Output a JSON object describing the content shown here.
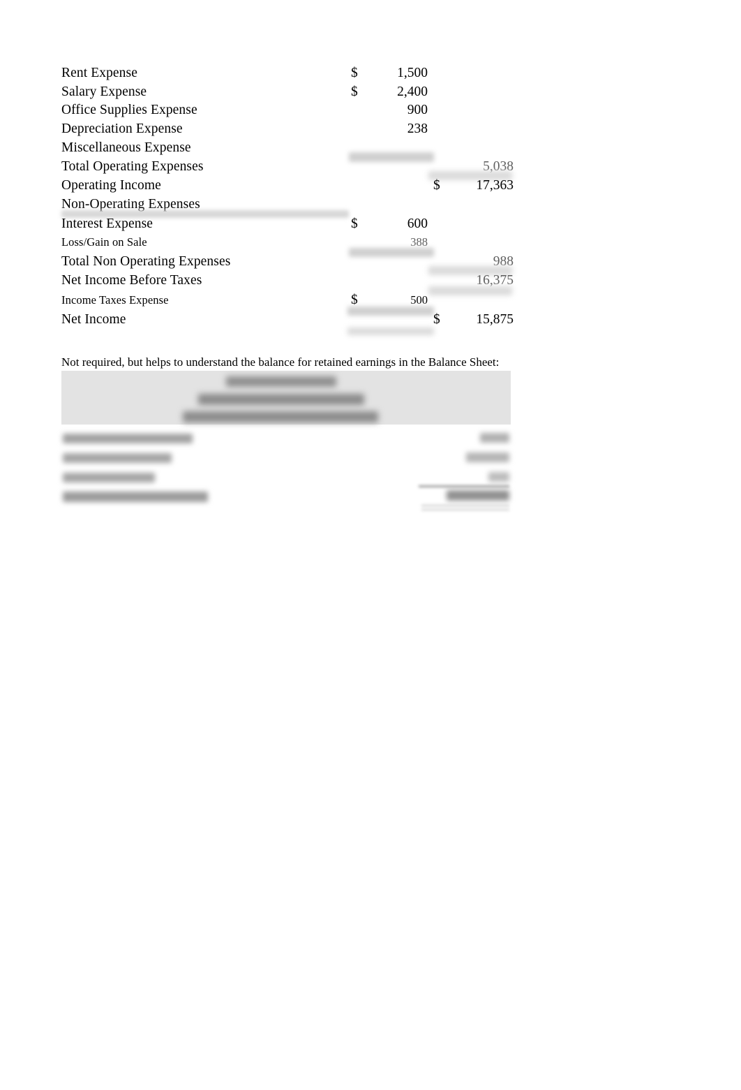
{
  "document": {
    "type": "income-statement-excerpt",
    "currency_symbol": "$"
  },
  "income_statement": {
    "rows": [
      {
        "label": "Rent Expense",
        "currency_a": "$",
        "value_a": "1,500",
        "currency_b": "",
        "value_b": ""
      },
      {
        "label": "Salary Expense",
        "currency_a": "$",
        "value_a": "2,400",
        "currency_b": "",
        "value_b": ""
      },
      {
        "label": "Office Supplies Expense",
        "currency_a": "",
        "value_a": "900",
        "currency_b": "",
        "value_b": ""
      },
      {
        "label": "Depreciation Expense",
        "currency_a": "",
        "value_a": "238",
        "currency_b": "",
        "value_b": ""
      },
      {
        "label": "Miscellaneous Expense",
        "currency_a": "",
        "value_a": "",
        "currency_b": "",
        "value_b": ""
      },
      {
        "label": "Total Operating Expenses",
        "currency_a": "",
        "value_a": "",
        "currency_b": "",
        "value_b": "5,038"
      },
      {
        "label": "Operating Income",
        "currency_a": "",
        "value_a": "",
        "currency_b": "$",
        "value_b": "17,363"
      },
      {
        "label": "Non-Operating Expenses",
        "currency_a": "",
        "value_a": "",
        "currency_b": "",
        "value_b": ""
      },
      {
        "label": "Interest Expense",
        "currency_a": "$",
        "value_a": "600",
        "currency_b": "",
        "value_b": ""
      },
      {
        "label": "Loss/Gain on Sale",
        "currency_a": "",
        "value_a": "388",
        "currency_b": "",
        "value_b": ""
      },
      {
        "label": "Total Non Operating Expenses",
        "currency_a": "",
        "value_a": "",
        "currency_b": "",
        "value_b": "988"
      },
      {
        "label": "Net Income Before Taxes",
        "currency_a": "",
        "value_a": "",
        "currency_b": "",
        "value_b": "16,375"
      },
      {
        "label": "Income Taxes Expense",
        "currency_a": "$",
        "value_a": "500",
        "currency_b": "",
        "value_b": ""
      },
      {
        "label": "Net Income",
        "currency_a": "",
        "value_a": "",
        "currency_b": "$",
        "value_b": "15,875"
      }
    ]
  },
  "note": {
    "text": "Not required, but helps to understand the balance for retained earnings in the Balance Sheet:"
  },
  "retained_earnings_statement": {
    "redacted": true,
    "title_lines": [
      "",
      "",
      ""
    ],
    "rows": [
      {
        "label": "",
        "value": ""
      },
      {
        "label": "",
        "value": ""
      },
      {
        "label": "",
        "value": ""
      },
      {
        "label": "",
        "value": ""
      }
    ]
  }
}
